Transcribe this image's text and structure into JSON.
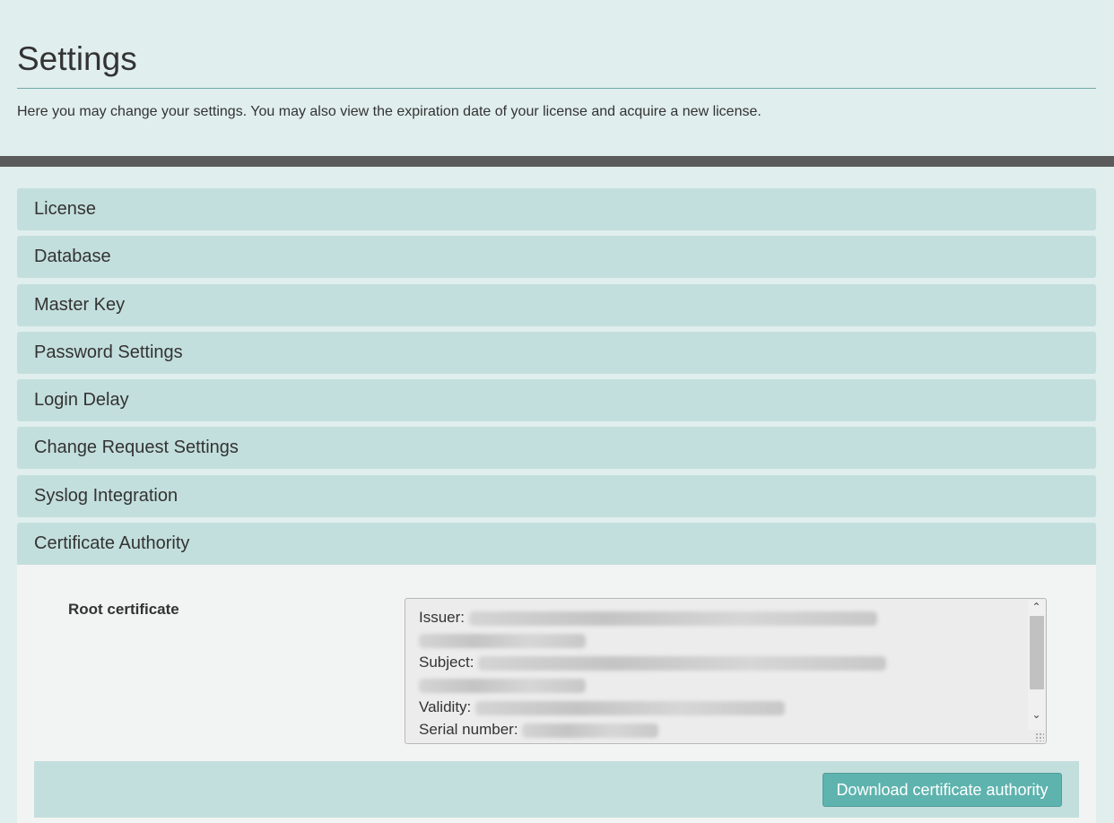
{
  "header": {
    "title": "Settings",
    "intro": "Here you may change your settings. You may also view the expiration date of your license and acquire a new license."
  },
  "accordion": {
    "items": [
      {
        "label": "License"
      },
      {
        "label": "Database"
      },
      {
        "label": "Master Key"
      },
      {
        "label": "Password Settings"
      },
      {
        "label": "Login Delay"
      },
      {
        "label": "Change Request Settings"
      },
      {
        "label": "Syslog Integration"
      },
      {
        "label": "Certificate Authority"
      }
    ],
    "open_index": 7
  },
  "certificate": {
    "field_label": "Root certificate",
    "issuer_label": "Issuer:",
    "subject_label": "Subject:",
    "validity_label": "Validity:",
    "serial_label": "Serial number:",
    "download_button": "Download certificate authority"
  },
  "icons": {
    "scroll_up": "chevron-up-icon",
    "scroll_down": "chevron-down-icon",
    "resize": "resize-grip-icon"
  },
  "colors": {
    "background": "#e0eeed",
    "accordion_header": "#c3dfdd",
    "button": "#5eb3ae",
    "dark_bar": "#5b5b5b"
  }
}
